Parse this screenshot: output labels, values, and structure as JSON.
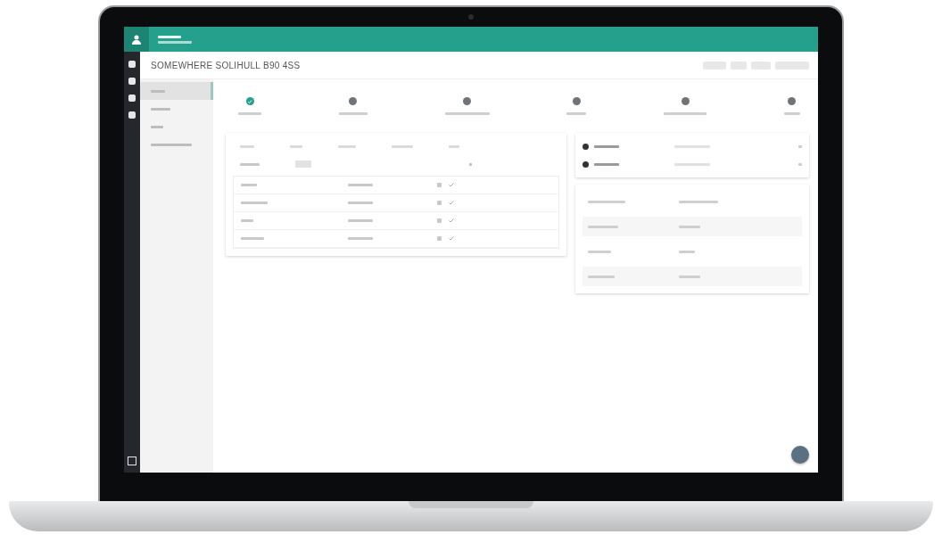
{
  "page": {
    "title": "SOMEWHERE SOLIHULL B90 4SS"
  },
  "sidebar": {
    "items": [
      {
        "selected": true
      },
      {
        "selected": false
      },
      {
        "selected": false
      },
      {
        "selected": false
      }
    ]
  },
  "steps": [
    {
      "done": true
    },
    {
      "done": false
    },
    {
      "done": false
    },
    {
      "done": false
    },
    {
      "done": false
    },
    {
      "done": false
    }
  ]
}
